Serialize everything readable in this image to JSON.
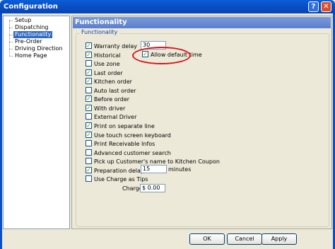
{
  "window": {
    "title": "Configuration",
    "help_glyph": "?",
    "close_glyph": "✕"
  },
  "tree": {
    "items": [
      {
        "label": "Setup",
        "selected": false
      },
      {
        "label": "Dispatching",
        "selected": false
      },
      {
        "label": "Functionality",
        "selected": true
      },
      {
        "label": "Pre-Order",
        "selected": false
      },
      {
        "label": "Driving Direction",
        "selected": false
      },
      {
        "label": "Home Page",
        "selected": false
      }
    ]
  },
  "panel": {
    "header": "Functionality",
    "group_label": "Functionality",
    "options": [
      {
        "label": "Warranty delay",
        "checked": true
      },
      {
        "label": "Historical",
        "checked": true
      },
      {
        "label": "Use zone",
        "checked": false
      },
      {
        "label": "Last order",
        "checked": true
      },
      {
        "label": "Kitchen order",
        "checked": true
      },
      {
        "label": "Auto last order",
        "checked": false
      },
      {
        "label": "Before order",
        "checked": true
      },
      {
        "label": "With driver",
        "checked": true
      },
      {
        "label": "External Driver",
        "checked": false
      },
      {
        "label": "Print on separate line",
        "checked": true
      },
      {
        "label": "Use touch screen keyboard",
        "checked": true
      },
      {
        "label": "Print Receivable Infos",
        "checked": false
      },
      {
        "label": "Advanced customer search",
        "checked": false
      },
      {
        "label": "Pick up Customer's name to Kitchen Coupon",
        "checked": false
      },
      {
        "label": "Preparation delay",
        "checked": true
      },
      {
        "label": "Use Charge as Tips",
        "checked": false
      }
    ],
    "allow_default_time": {
      "label": "Allow default time",
      "checked": true
    },
    "warranty_delay_value": "30",
    "preparation_delay_value": "15",
    "preparation_delay_unit": "minutes",
    "charge_label": "Charge",
    "charge_value": "$ 0.00",
    "check_glyph": "✓"
  },
  "buttons": {
    "ok": "OK",
    "cancel": "Cancel",
    "apply": "Apply"
  },
  "colors": {
    "annotation_circle": "#d8141a",
    "check": "#21a121",
    "selection": "#316ac5"
  }
}
